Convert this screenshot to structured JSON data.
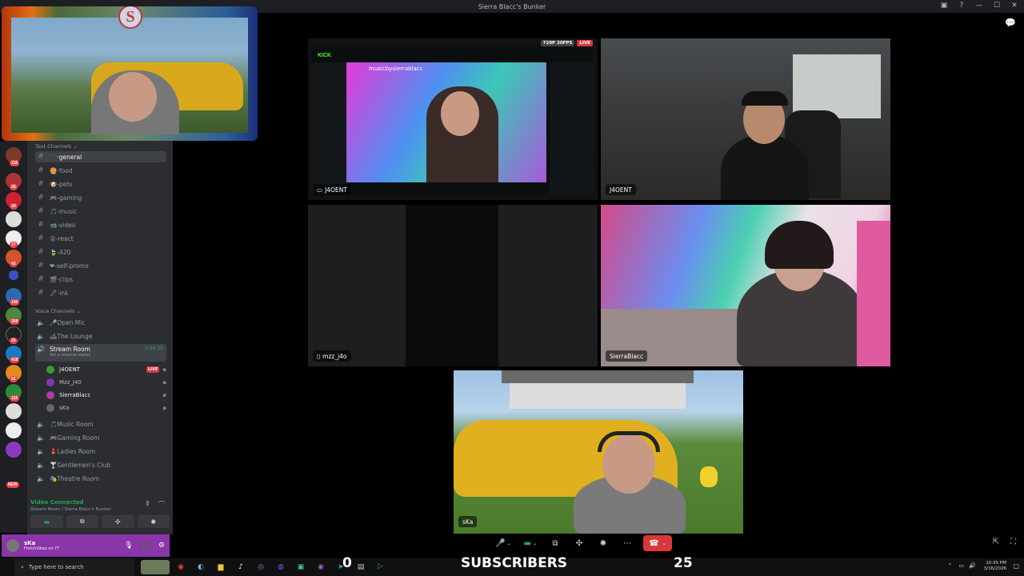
{
  "window": {
    "title": "Sierra Blacc's Bunker"
  },
  "rail_badges": [
    "116",
    "28",
    "34",
    "17",
    "43",
    "140",
    "268",
    "24",
    "418",
    "53",
    "116",
    "NEW"
  ],
  "sidebar": {
    "text_category": "Text Channels",
    "text_channels": [
      {
        "name": "·general",
        "icon": "🖤"
      },
      {
        "name": "-food",
        "icon": "🍔"
      },
      {
        "name": "-pets",
        "icon": "🐶"
      },
      {
        "name": "-gaming",
        "icon": "🎮"
      },
      {
        "name": "-music",
        "icon": "🎵"
      },
      {
        "name": "-video",
        "icon": "📹"
      },
      {
        "name": "-react",
        "icon": "😲"
      },
      {
        "name": "-420",
        "icon": "🍃"
      },
      {
        "name": "-self-promo",
        "icon": "❤"
      },
      {
        "name": "-clips",
        "icon": "🎬"
      },
      {
        "name": "-ink",
        "icon": "🖋"
      }
    ],
    "voice_category": "Voice Channels",
    "voice_channels_top": [
      {
        "name": "Open Mic",
        "icon": "🎤"
      },
      {
        "name": "The Lounge",
        "icon": "🛋"
      }
    ],
    "active_room": {
      "name": "Stream Room",
      "time": "2:34:30",
      "status": "Set a channel status"
    },
    "room_users": [
      {
        "name": "J4OENT",
        "live": "LIVE",
        "color": "#3c9a3c"
      },
      {
        "name": "Mzz_J40",
        "live": "",
        "color": "#7a3cb0"
      },
      {
        "name": "SierraBlacc",
        "live": "",
        "color": "#b03ca0"
      },
      {
        "name": "sKa",
        "live": "",
        "color": "#666"
      }
    ],
    "voice_channels_bottom": [
      {
        "name": "Music Room",
        "icon": "🎵"
      },
      {
        "name": "Gaming Room",
        "icon": "🎮"
      },
      {
        "name": "Ladies Room",
        "icon": "💄"
      },
      {
        "name": "Gentlemen's Club",
        "icon": "🍸"
      },
      {
        "name": "Theatre Room",
        "icon": "🎭"
      }
    ],
    "connection": {
      "status": "Video Connected",
      "sub": "Stream Room / Sierra Blacc's Bunker"
    },
    "user": {
      "name": "sKa",
      "sub": "FletchVibez on YT"
    }
  },
  "webcam_logo": "S",
  "tiles": {
    "screen": {
      "label": "J4OENT",
      "badge_res": "720P 30FPS",
      "badge_live": "LIVE",
      "kick": "KICK",
      "stream_title": "musicbysierrablacc"
    },
    "cam_j4oent": {
      "label": "J4OENT"
    },
    "mzz": {
      "label": "mzz_j4o"
    },
    "sierra": {
      "label": "SierraBlacc"
    },
    "ska": {
      "label": "sKa"
    }
  },
  "taskbar": {
    "search_placeholder": "Type here to search",
    "sub_left": "0",
    "sub_label": "SUBSCRIBERS",
    "sub_right": "25",
    "time": "10:35 PM",
    "date": "3/16/2026"
  }
}
